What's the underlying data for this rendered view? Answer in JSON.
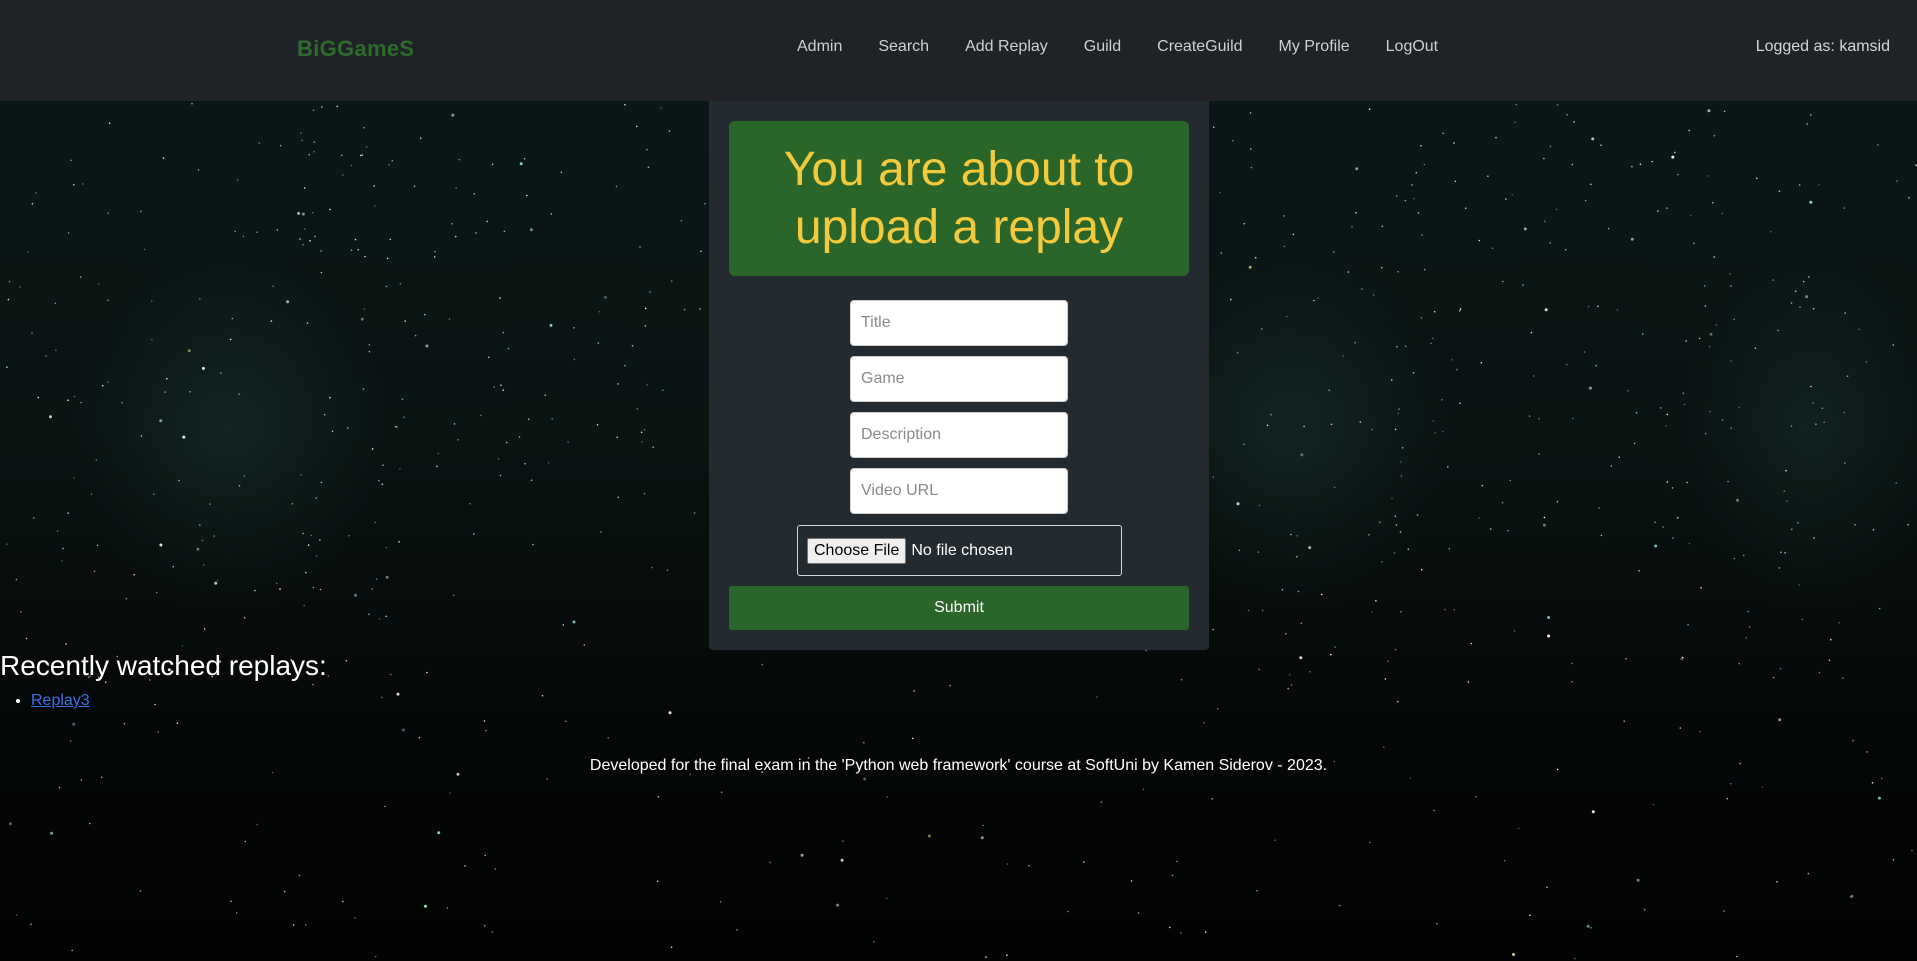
{
  "header": {
    "brand": "BiGGameS",
    "nav": [
      {
        "label": "Admin"
      },
      {
        "label": "Search"
      },
      {
        "label": "Add Replay"
      },
      {
        "label": "Guild"
      },
      {
        "label": "CreateGuild"
      },
      {
        "label": "My Profile"
      },
      {
        "label": "LogOut"
      }
    ],
    "logged_in": "Logged as: kamsid"
  },
  "form": {
    "heading": "You are about to upload a replay",
    "fields": {
      "title": {
        "placeholder": "Title",
        "value": ""
      },
      "game": {
        "placeholder": "Game",
        "value": ""
      },
      "description": {
        "placeholder": "Description",
        "value": ""
      },
      "video_url": {
        "placeholder": "Video URL",
        "value": ""
      }
    },
    "file": {
      "button_label": "Choose File",
      "status": "No file chosen"
    },
    "submit_label": "Submit"
  },
  "recent": {
    "heading": "Recently watched replays:",
    "items": [
      {
        "label": "Replay3"
      }
    ]
  },
  "footer": {
    "text": "Developed for the final exam in the 'Python web framework' course at SoftUni by Kamen Siderov - 2023."
  },
  "colors": {
    "header_bg": "#1f2327",
    "brand": "#2c6b2c",
    "card_bg": "#232b30",
    "accent_green": "#2a662a",
    "heading_yellow": "#f4c93c",
    "link_blue": "#3d6fe6"
  }
}
